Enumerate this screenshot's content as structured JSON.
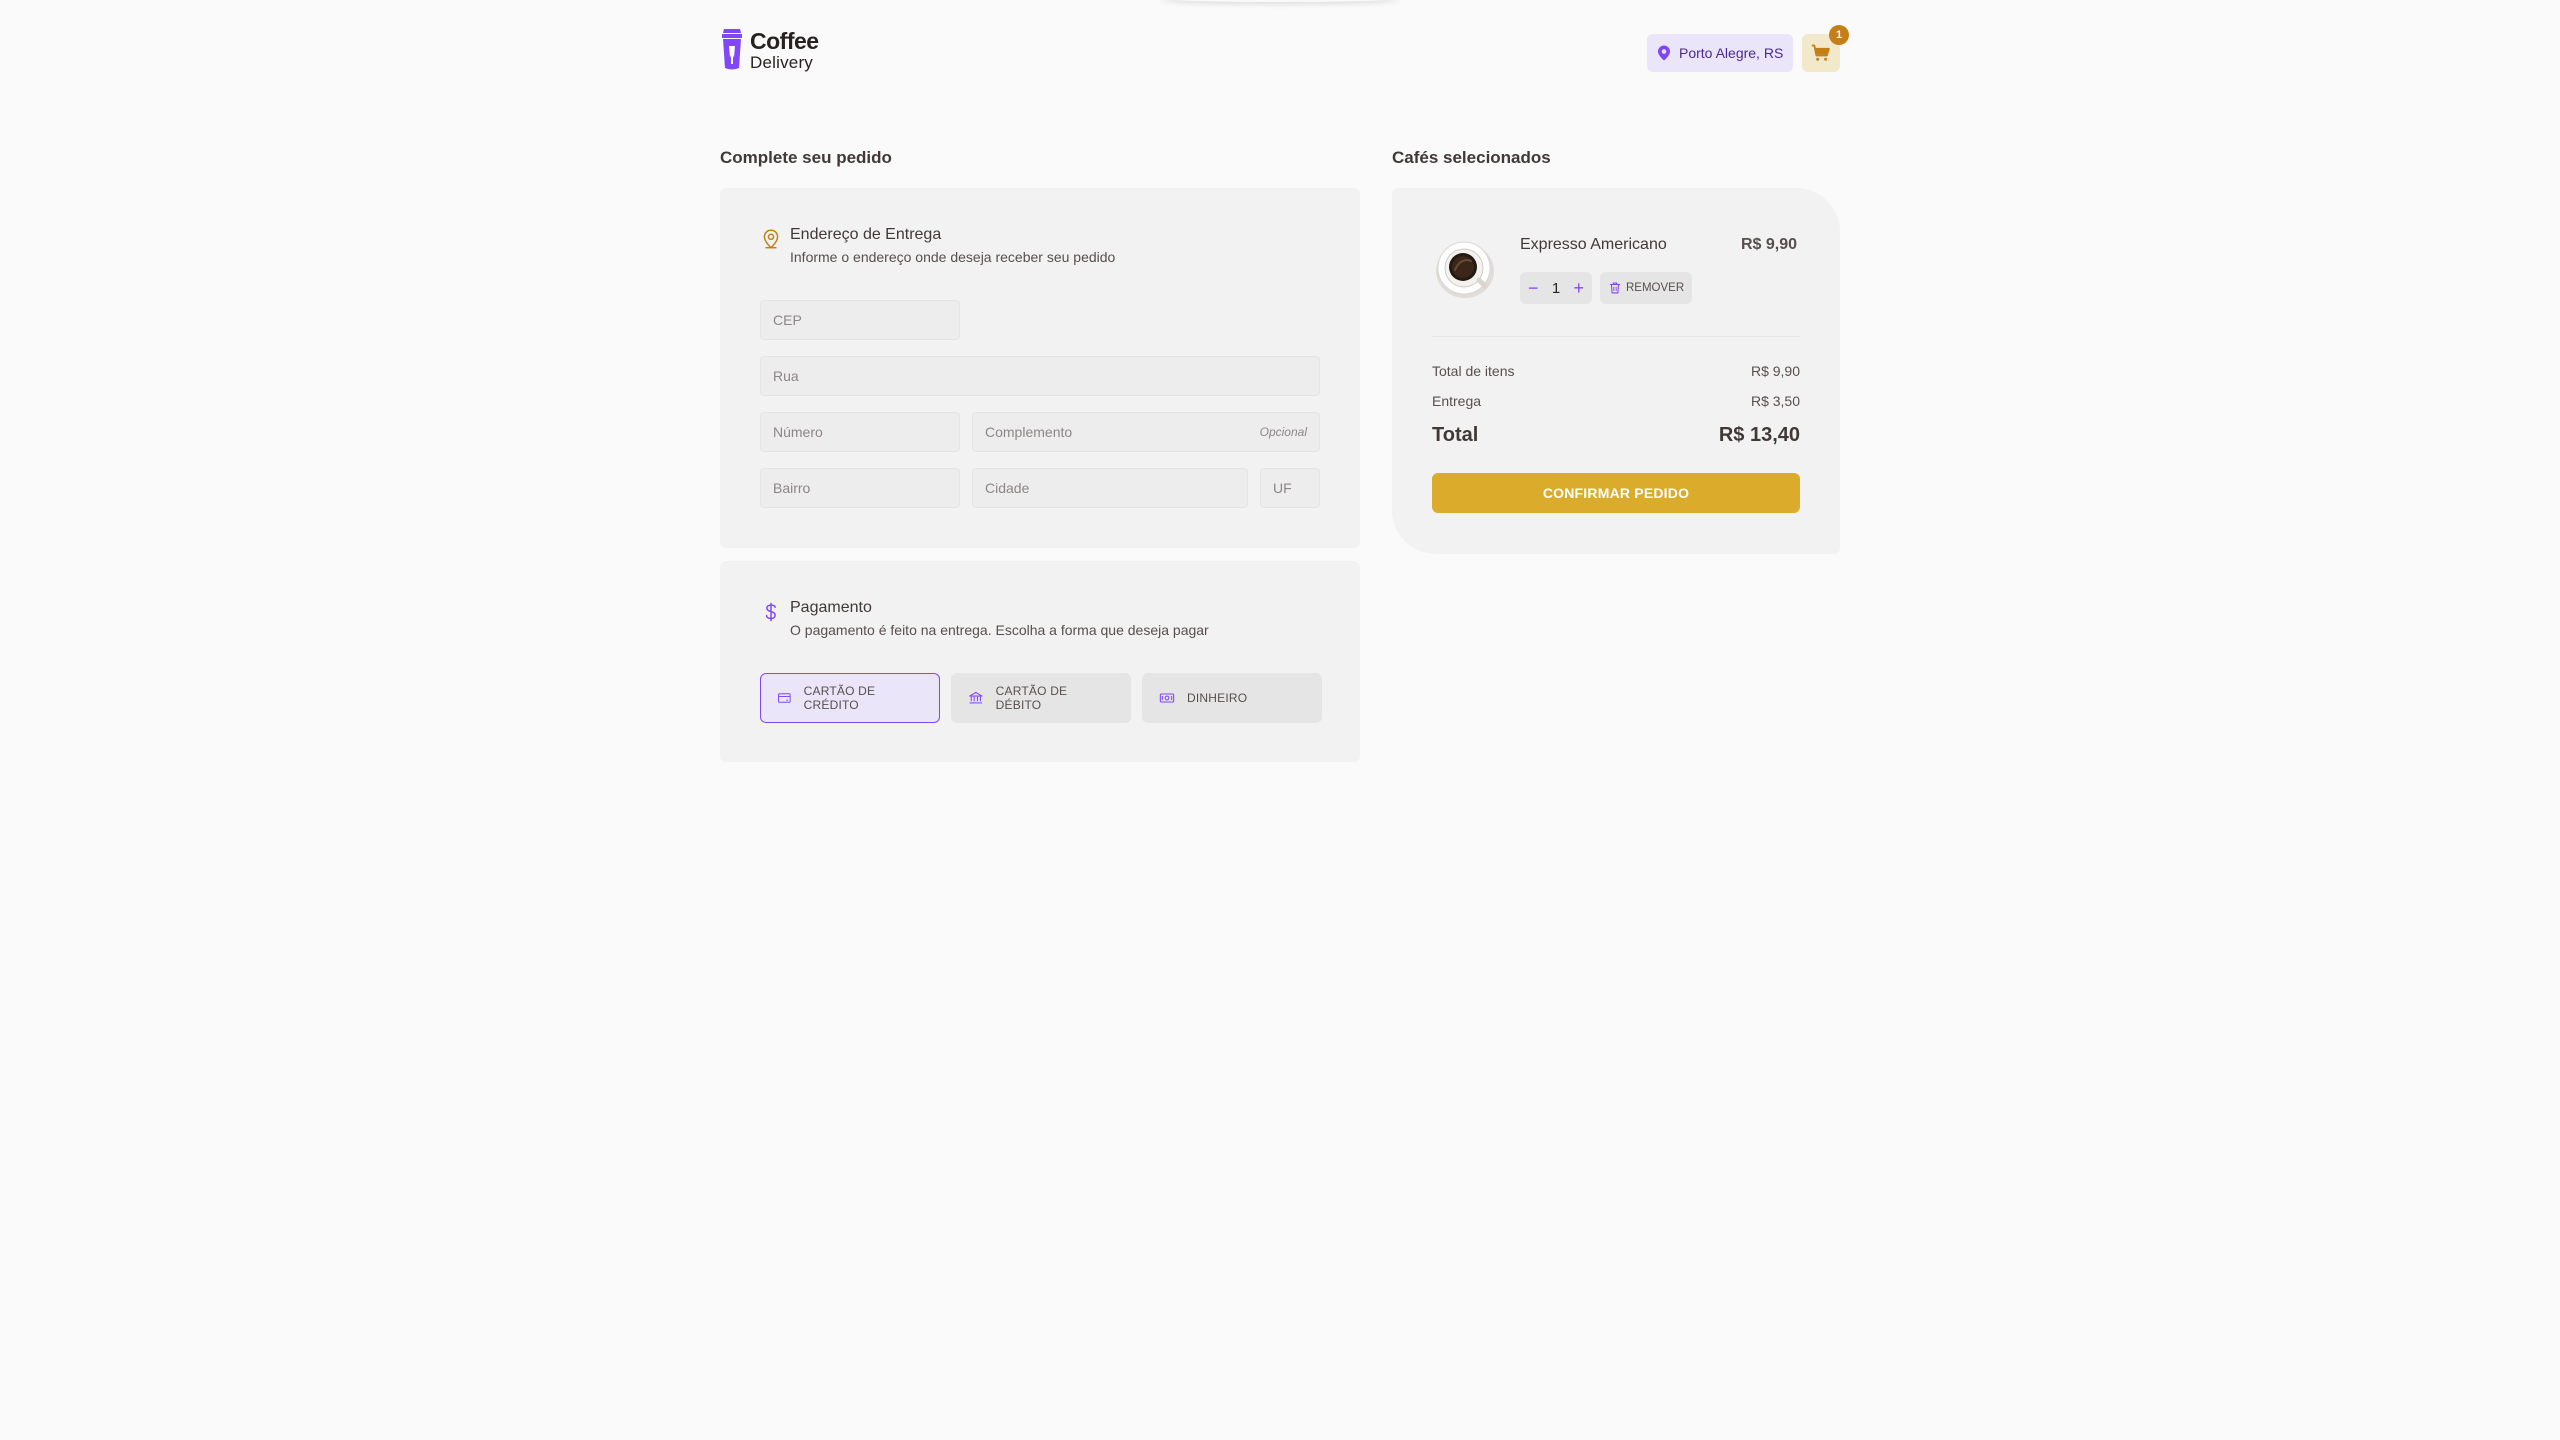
{
  "header": {
    "logo_title": "Coffee",
    "logo_subtitle": "Delivery",
    "location": "Porto Alegre, RS",
    "cart_count": "1"
  },
  "checkout": {
    "title": "Complete seu pedido",
    "address": {
      "title": "Endereço de Entrega",
      "subtitle": "Informe o endereço onde deseja receber seu pedido",
      "fields": {
        "cep": "CEP",
        "rua": "Rua",
        "numero": "Número",
        "complemento": "Complemento",
        "complemento_hint": "Opcional",
        "bairro": "Bairro",
        "cidade": "Cidade",
        "uf": "UF"
      }
    },
    "payment": {
      "title": "Pagamento",
      "subtitle": "O pagamento é feito na entrega. Escolha a forma que deseja pagar",
      "options": [
        {
          "label": "CARTÃO DE CRÉDITO",
          "icon": "credit-card-icon",
          "selected": true
        },
        {
          "label": "CARTÃO DE DÉBITO",
          "icon": "bank-icon",
          "selected": false
        },
        {
          "label": "DINHEIRO",
          "icon": "money-icon",
          "selected": false
        }
      ]
    }
  },
  "summary": {
    "title": "Cafés selecionados",
    "items": [
      {
        "name": "Expresso Americano",
        "price": "R$ 9,90",
        "quantity": "1",
        "remove_label": "REMOVER"
      }
    ],
    "total_items_label": "Total de itens",
    "total_items_value": "R$ 9,90",
    "delivery_label": "Entrega",
    "delivery_value": "R$ 3,50",
    "total_label": "Total",
    "total_value": "R$ 13,40",
    "confirm_label": "CONFIRMAR PEDIDO"
  },
  "colors": {
    "purple": "#8047f8",
    "purple_dark": "#4b2995",
    "purple_light": "#ebe5f9",
    "yellow": "#dbac2c",
    "yellow_dark": "#c47f17",
    "yellow_light": "#f1e9c9"
  }
}
